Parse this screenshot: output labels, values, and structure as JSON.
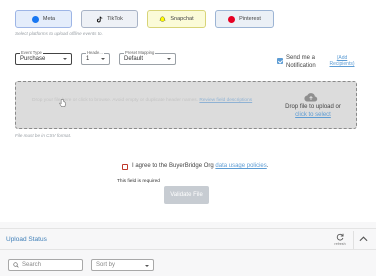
{
  "platforms": [
    {
      "label": "Meta",
      "icon": "meta-icon",
      "color": "#1877f2"
    },
    {
      "label": "TikTok",
      "icon": "tiktok-icon",
      "color": "#111111"
    },
    {
      "label": "Snapchat",
      "icon": "snapchat-icon",
      "color": "#fffc00"
    },
    {
      "label": "Pinterest",
      "icon": "pinterest-icon",
      "color": "#e60023"
    }
  ],
  "platform_hint": "Select platforms to upload offline events to.",
  "event_type": {
    "label": "Event Type",
    "value": "Purchase"
  },
  "header": {
    "label": "Heade...",
    "value": "1"
  },
  "preset_mapping": {
    "label": "Preset Mapping",
    "value": "Default"
  },
  "notify": {
    "label": "Send me a Notification",
    "checked": true,
    "add_recipients": "(Add Recipients)"
  },
  "dropzone": {
    "instructions": "Drop your file here or click to browse. Avoid empty or duplicate header names.",
    "link": "Review field descriptions",
    "upload_text": "Drop file to upload or",
    "select_link": "click to select",
    "icon": "cloud-upload-icon"
  },
  "csv_note": "File must be in CSV format.",
  "agree": {
    "text": "I agree to the BuyerBridge Org",
    "link": "data usage policies",
    "suffix": "."
  },
  "required_text": "This field is required",
  "validate_label": "Validate File",
  "upload_status": {
    "title": "Upload Status",
    "refresh_label": "refresh"
  },
  "search": {
    "placeholder": "Search"
  },
  "sort": {
    "placeholder": "Sort by"
  },
  "colors": {
    "accent": "#5d9cd4",
    "error": "#c0392b"
  }
}
